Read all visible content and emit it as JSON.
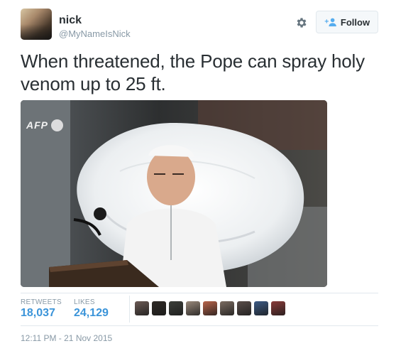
{
  "author": {
    "name": "nick",
    "handle": "@MyNameIsNick"
  },
  "actions": {
    "follow_label": "Follow"
  },
  "tweet": {
    "text": "When threatened, the Pope can spray holy venom up to 25 ft.",
    "photo_watermark": "AFP"
  },
  "stats": {
    "retweets_label": "RETWEETS",
    "retweets_value": "18,037",
    "likes_label": "LIKES",
    "likes_value": "24,129"
  },
  "likers": [
    {
      "color": "#6b5a54"
    },
    {
      "color": "#2f2a26"
    },
    {
      "color": "#3c3f3a"
    },
    {
      "color": "#9a8a7c"
    },
    {
      "color": "#b8644a"
    },
    {
      "color": "#7b6c61"
    },
    {
      "color": "#5a4e4a"
    },
    {
      "color": "#3d5b86"
    },
    {
      "color": "#8a3c3a"
    }
  ],
  "timestamp": "12:11 PM - 21 Nov 2015",
  "colors": {
    "link": "#3b94d9",
    "muted": "#8899a6",
    "text": "#292f33"
  }
}
